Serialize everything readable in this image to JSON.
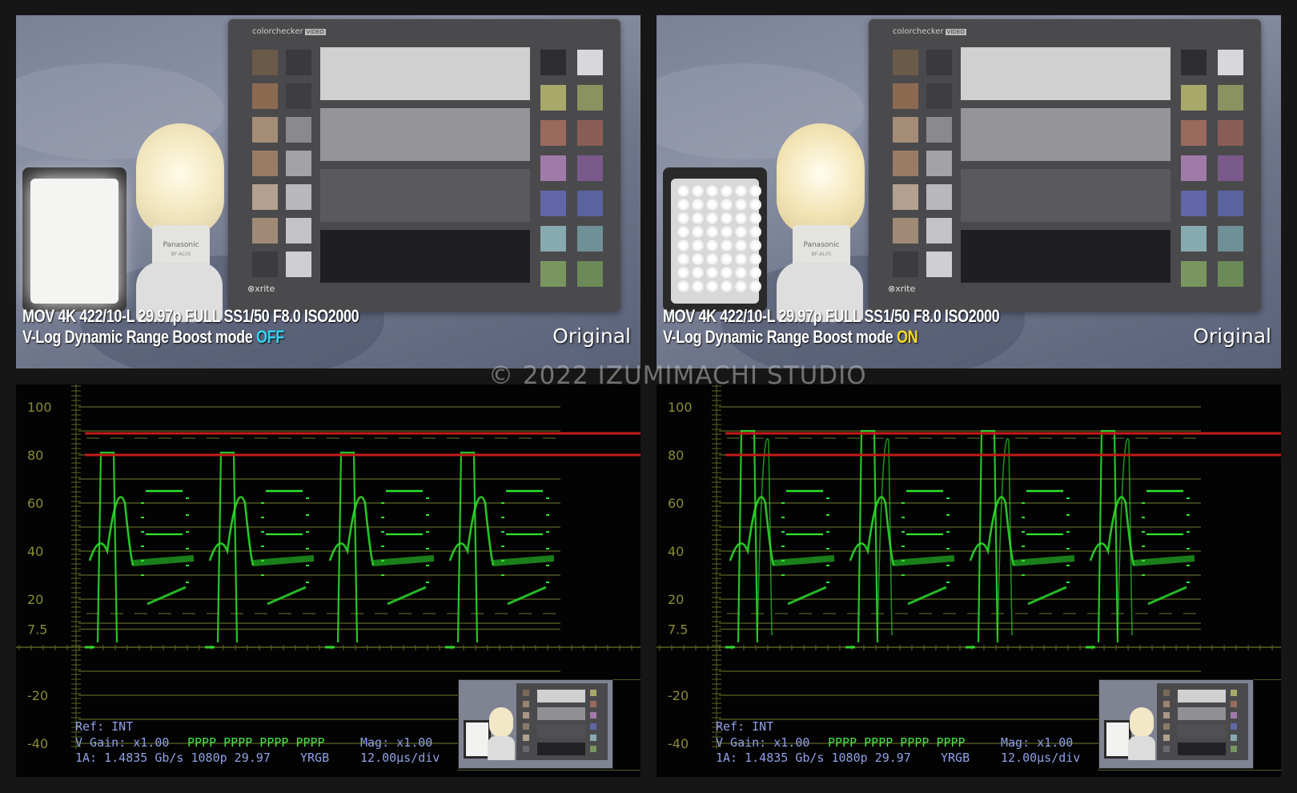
{
  "left": {
    "caption_line1": "MOV  4K  422/10-L  29.97p  FULL  SS1/50  F8.0  ISO2000",
    "caption_line2_prefix": "V-Log  Dynamic Range Boost mode ",
    "caption_line2_mode": "OFF",
    "original_label": "Original",
    "mode_color": "#34d3f0"
  },
  "right": {
    "caption_line1": "MOV  4K  422/10-L  29.97p  FULL  SS1/50  F8.0  ISO2000",
    "caption_line2_prefix": "V-Log  Dynamic Range Boost mode ",
    "caption_line2_mode": "ON",
    "original_label": "Original",
    "mode_color": "#f4dc2a"
  },
  "scene": {
    "chart_brand": "colorchecker",
    "chart_brand_tag": "VIDEO",
    "xrite_logo": "xrite",
    "bulb_brand": "Panasonic",
    "bulb_model": "BF-AL05"
  },
  "copyright": "© 2022 IZUMIMACHI STUDIO",
  "waveform": {
    "y_labels": [
      "100",
      "80",
      "60",
      "40",
      "20",
      "7.5",
      "-20",
      "-40"
    ],
    "ref_reference_lines": [
      89,
      80
    ],
    "status": {
      "ref": "Ref: INT",
      "vgain": "V Gain:  x1.00",
      "pppp": "PPPP PPPP PPPP PPPP",
      "mag": "Mag:  x1.00",
      "link": "1A: 1.4835 Gb/s  1080p 29.97",
      "mode": "YRGB",
      "timebase": "12.00µs/div"
    },
    "trace_color": "#2ee62e",
    "reference_line_color": "#c41a1a"
  }
}
